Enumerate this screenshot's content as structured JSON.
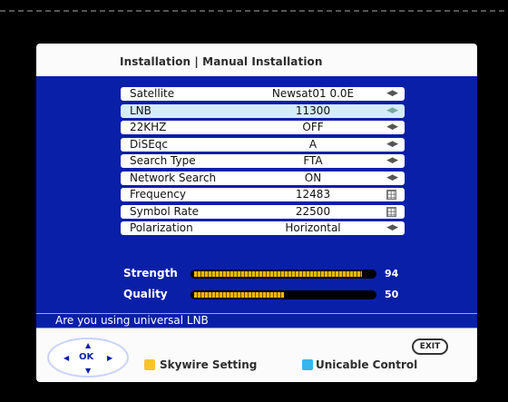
{
  "title": "Installation | Manual Installation",
  "menu": {
    "rows": [
      {
        "label": "Satellite",
        "value": "Newsat01 0.0E",
        "control": "arrows"
      },
      {
        "label": "LNB",
        "value": "11300",
        "control": "arrows",
        "selected": true
      },
      {
        "label": "22KHZ",
        "value": "OFF",
        "control": "arrows"
      },
      {
        "label": "DiSEqc",
        "value": "A",
        "control": "arrows"
      },
      {
        "label": "Search Type",
        "value": "FTA",
        "control": "arrows"
      },
      {
        "label": "Network Search",
        "value": "ON",
        "control": "arrows"
      },
      {
        "label": "Frequency",
        "value": "12483",
        "control": "keypad"
      },
      {
        "label": "Symbol Rate",
        "value": "22500",
        "control": "keypad"
      },
      {
        "label": "Polarization",
        "value": "Horizontal",
        "control": "arrows"
      }
    ]
  },
  "signal": {
    "strength": {
      "label": "Strength",
      "value": "94",
      "level": 0.94
    },
    "quality": {
      "label": "Quality",
      "value": "50",
      "level": 0.5
    }
  },
  "message": "Are you using universal LNB",
  "footer": {
    "nav_ok": "OK",
    "yellow_label": "Skywire Setting",
    "blue_label": "Unicable Control",
    "exit_label": "EXIT"
  },
  "colors": {
    "panel_blue": "#0a1fa8",
    "yellow_key": "#f7c52b",
    "blue_key": "#35b6ee",
    "bar_fill": "#f5b800",
    "selected_row": "#d5ecfc"
  },
  "icons": {
    "arrows": "left-right-arrows-icon",
    "keypad": "keypad-icon",
    "nav": "navigation-pad-icon"
  }
}
